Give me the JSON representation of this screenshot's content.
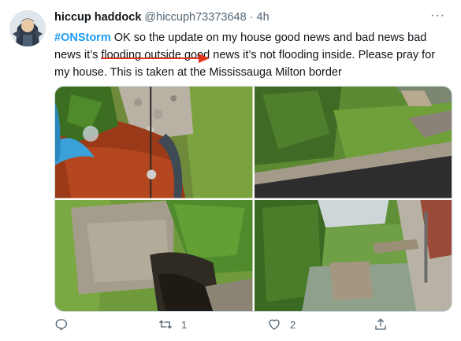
{
  "tweet": {
    "display_name": "hiccup haddock",
    "handle": "@hiccuph73373648",
    "separator": "·",
    "time": "4h",
    "more_label": "···",
    "hashtag": "#ONStorm",
    "text_after_hashtag": " OK so the update on my house good news and bad news bad news it’s flooding outside good news it’s not flooding inside. Please pray for my house. This is taken at the Mississauga Milton border"
  },
  "media": {
    "photos": [
      {
        "subject": "garden bed with red mulch and bird bath"
      },
      {
        "subject": "lawn beside driveway"
      },
      {
        "subject": "patio slab and ferns"
      },
      {
        "subject": "flooded side yard"
      }
    ]
  },
  "actions": {
    "reply": {
      "icon": "reply-icon",
      "count": ""
    },
    "retweet": {
      "icon": "retweet-icon",
      "count": "1"
    },
    "like": {
      "icon": "heart-icon",
      "count": "2"
    },
    "share": {
      "icon": "share-icon",
      "count": ""
    }
  },
  "colors": {
    "accent": "#1d9bf0",
    "secondary_text": "#536471",
    "annotation_red": "#e0341e"
  }
}
